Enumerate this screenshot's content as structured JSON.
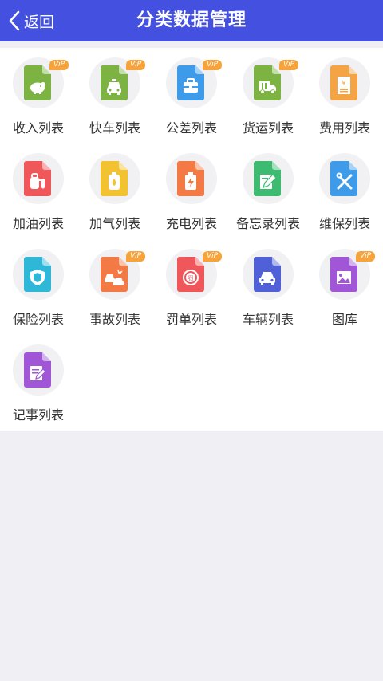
{
  "header": {
    "back_label": "返回",
    "title": "分类数据管理",
    "bg_color": "#4451e0"
  },
  "vip_label": "ViP",
  "items": [
    {
      "label": "收入列表",
      "icon": "piggy-bank-icon",
      "color": "#7cb342",
      "vip": true
    },
    {
      "label": "快车列表",
      "icon": "taxi-icon",
      "color": "#7cb342",
      "vip": true
    },
    {
      "label": "公差列表",
      "icon": "briefcase-icon",
      "color": "#3d9be9",
      "vip": true
    },
    {
      "label": "货运列表",
      "icon": "truck-icon",
      "color": "#7cb342",
      "vip": true
    },
    {
      "label": "费用列表",
      "icon": "yuan-receipt-icon",
      "color": "#f5a445",
      "vip": false
    },
    {
      "label": "加油列表",
      "icon": "fuel-pump-icon",
      "color": "#f0575a",
      "vip": false
    },
    {
      "label": "加气列表",
      "icon": "gas-tank-icon",
      "color": "#f2c230",
      "vip": false
    },
    {
      "label": "充电列表",
      "icon": "battery-charge-icon",
      "color": "#f47a45",
      "vip": false
    },
    {
      "label": "备忘录列表",
      "icon": "memo-pen-icon",
      "color": "#3dbb70",
      "vip": false
    },
    {
      "label": "维保列表",
      "icon": "wrench-screwdriver-icon",
      "color": "#3d9be9",
      "vip": false
    },
    {
      "label": "保险列表",
      "icon": "shield-icon",
      "color": "#2fb7d8",
      "vip": false
    },
    {
      "label": "事故列表",
      "icon": "car-accident-icon",
      "color": "#f47a45",
      "vip": true
    },
    {
      "label": "罚单列表",
      "icon": "fine-stamp-icon",
      "color": "#f0575a",
      "vip": true
    },
    {
      "label": "车辆列表",
      "icon": "car-icon",
      "color": "#5060d8",
      "vip": false
    },
    {
      "label": "图库",
      "icon": "image-gallery-icon",
      "color": "#a156d8",
      "vip": true
    },
    {
      "label": "记事列表",
      "icon": "note-edit-icon",
      "color": "#a156d8",
      "vip": false
    }
  ]
}
